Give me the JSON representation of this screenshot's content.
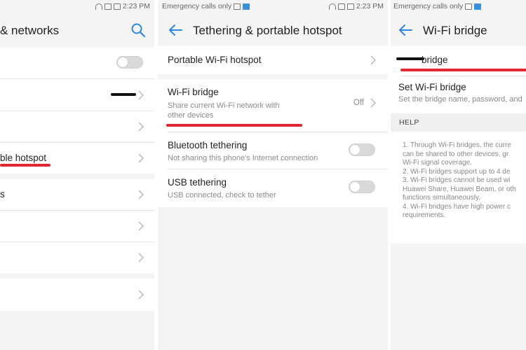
{
  "panel1": {
    "status_time": "2:23 PM",
    "title": "& networks",
    "rows": [
      {
        "label": ""
      },
      {
        "label": ""
      },
      {
        "label": ""
      },
      {
        "label": "ble hotspot"
      },
      {
        "label": "s"
      },
      {
        "label": ""
      },
      {
        "label": ""
      },
      {
        "label": ""
      }
    ]
  },
  "panel2": {
    "status_left": "Emergency calls only",
    "status_time": "2:23 PM",
    "title": "Tethering & portable hotspot",
    "rows": [
      {
        "label": "Portable Wi-Fi hotspot"
      },
      {
        "label": "Wi-Fi bridge",
        "sub": "Share current Wi-Fi network with\nother devices",
        "value": "Off"
      },
      {
        "label": "Bluetooth tethering",
        "sub": "Not sharing this phone's Internet connection"
      },
      {
        "label": "USB tethering",
        "sub": "USB connected, check to tether"
      }
    ]
  },
  "panel3": {
    "status_left": "Emergency calls only",
    "title": "Wi-Fi bridge",
    "rows": [
      {
        "label": "bridge"
      },
      {
        "label": "Set Wi-Fi bridge",
        "sub": "Set the bridge name, password, and"
      }
    ],
    "help_header": "HELP",
    "help_lines": [
      "1. Through Wi-Fi bridges, the curre",
      "can be shared to other devices, gr",
      "Wi-Fi signal coverage.",
      "2. Wi-Fi bridges support up to 4 de",
      "3. Wi-Fi bridges cannot be used wi",
      "Huawei Share, Huawei Beam, or oth",
      "functions simultaneously.",
      "4. Wi-Fi bridges have high power c",
      "requirements."
    ]
  },
  "colors": {
    "accent": "#2e86de",
    "annotation": "#e0262e"
  }
}
